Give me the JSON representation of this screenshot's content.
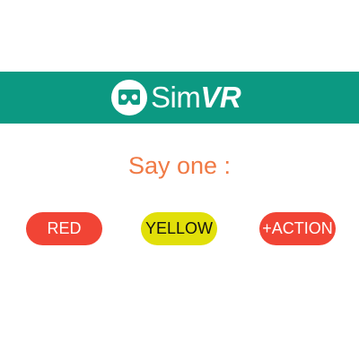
{
  "header": {
    "brand_prefix": "Sim",
    "brand_suffix": "VR",
    "background_color": "#0c9982",
    "logo_icon": "vr-headset-icon"
  },
  "prompt": {
    "text": "Say one :",
    "color": "#f07a45"
  },
  "choices": [
    {
      "label": "RED",
      "color": "#f14435",
      "text_color": "#ffffff"
    },
    {
      "label": "YELLOW",
      "color": "#e1df09",
      "text_color": "#111111"
    },
    {
      "label": "+ACTION",
      "color": "#f14435",
      "text_color": "#ffffff"
    }
  ]
}
